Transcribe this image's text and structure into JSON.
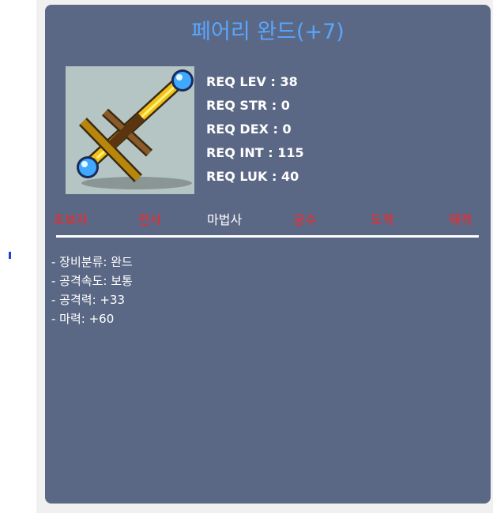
{
  "item": {
    "name": "페어리 완드(+7)",
    "image_icon": "fairy-wand-icon"
  },
  "requirements": [
    "REQ LEV : 38",
    "REQ STR : 0",
    "REQ DEX : 0",
    "REQ INT : 115",
    "REQ LUK : 40"
  ],
  "jobs": [
    {
      "label": "초보자",
      "available": false
    },
    {
      "label": "전사",
      "available": false
    },
    {
      "label": "마법사",
      "available": true
    },
    {
      "label": "궁수",
      "available": false
    },
    {
      "label": "도적",
      "available": false
    },
    {
      "label": "해적",
      "available": false
    }
  ],
  "description": [
    "- 장비분류: 완드",
    "- 공격속도: 보통",
    "- 공격력: +33",
    "- 마력: +60"
  ],
  "colors": {
    "card": "#5b6885",
    "title": "#58a6ff",
    "job_unavailable": "#ff2222",
    "job_available": "#ffffff"
  }
}
